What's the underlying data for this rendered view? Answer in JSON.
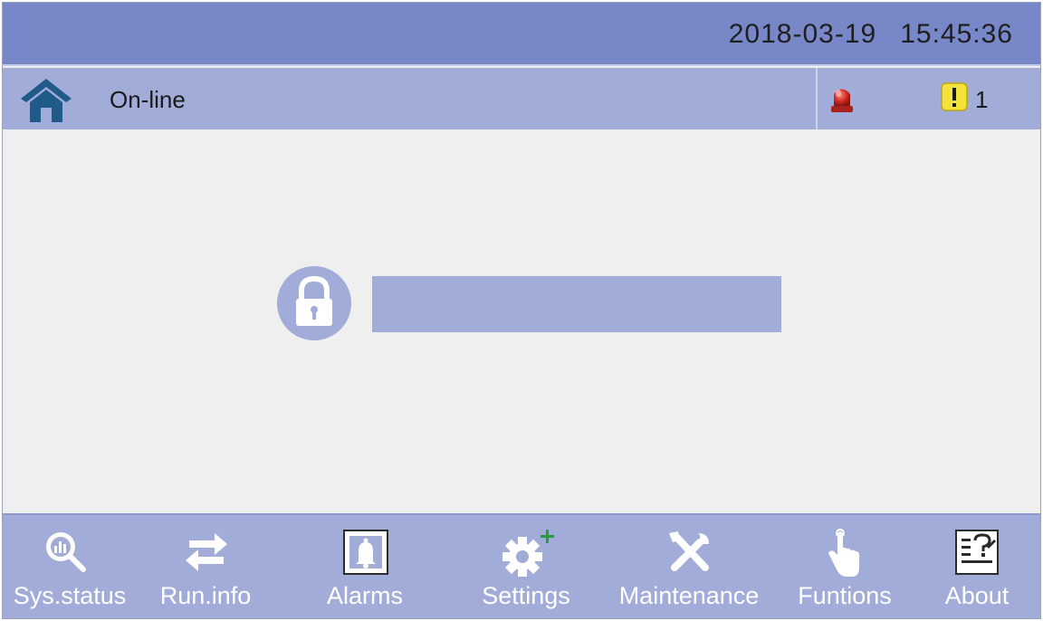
{
  "header": {
    "date": "2018-03-19",
    "time": "15:45:36"
  },
  "status": {
    "home_icon": "home-icon",
    "mode": "On-line",
    "alarm_icon": "alarm-light-icon",
    "warning_icon": "warning-icon",
    "warning_count": "1"
  },
  "login": {
    "lock_icon": "lock-icon",
    "password_value": ""
  },
  "nav": {
    "items": [
      {
        "label": "Sys.status",
        "icon": "magnifier-chart-icon"
      },
      {
        "label": "Run.info",
        "icon": "swap-arrows-icon"
      },
      {
        "label": "Alarms",
        "icon": "bell-icon"
      },
      {
        "label": "Settings",
        "icon": "gear-plus-icon"
      },
      {
        "label": "Maintenance",
        "icon": "tools-icon"
      },
      {
        "label": "Funtions",
        "icon": "touch-hand-icon"
      },
      {
        "label": "About",
        "icon": "about-doc-icon"
      }
    ]
  },
  "colors": {
    "topbar": "#7787c7",
    "panel": "#a2acd9",
    "background": "#efefef",
    "home_icon": "#1f5a88",
    "alarm": "#d42a22",
    "warning": "#f2e23a",
    "plus": "#2a9a3a"
  }
}
